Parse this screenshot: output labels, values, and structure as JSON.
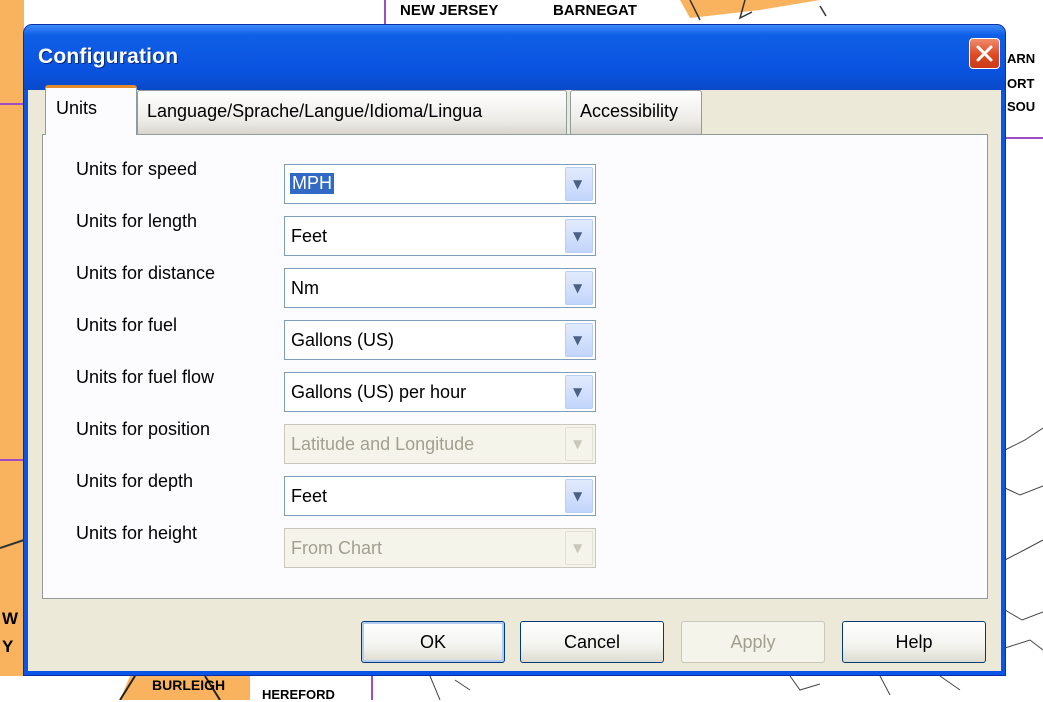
{
  "map": {
    "labels": [
      "NEW JERSEY",
      "BARNEGAT",
      "ARN",
      "ORT",
      "SOU",
      "BURLEIGH",
      "HEREFORD",
      "W",
      "Y"
    ]
  },
  "window": {
    "title": "Configuration",
    "close_icon": "close-icon"
  },
  "tabs": [
    {
      "label": "Units",
      "active": true
    },
    {
      "label": "Language/Sprache/Langue/Idioma/Lingua",
      "active": false
    },
    {
      "label": "Accessibility",
      "active": false
    }
  ],
  "units": [
    {
      "label": "Units for speed",
      "value": "MPH",
      "enabled": true,
      "selected": true
    },
    {
      "label": "Units for length",
      "value": "Feet",
      "enabled": true
    },
    {
      "label": "Units for distance",
      "value": "Nm",
      "enabled": true
    },
    {
      "label": "Units for fuel",
      "value": "Gallons (US)",
      "enabled": true
    },
    {
      "label": "Units for fuel flow",
      "value": "Gallons (US) per hour",
      "enabled": true
    },
    {
      "label": "Units for position",
      "value": "Latitude and Longitude",
      "enabled": false
    },
    {
      "label": "Units for depth",
      "value": "Feet",
      "enabled": true
    },
    {
      "label": "Units for height",
      "value": "From Chart",
      "enabled": false
    }
  ],
  "buttons": {
    "ok": "OK",
    "cancel": "Cancel",
    "apply": "Apply",
    "help": "Help"
  },
  "colors": {
    "titlebar": "#0a55e6",
    "client": "#ece9d8",
    "map_land": "#f9b35e",
    "map_border": "#a04cc4",
    "active_tab_accent": "#e68b2c",
    "selection": "#316ac5"
  }
}
